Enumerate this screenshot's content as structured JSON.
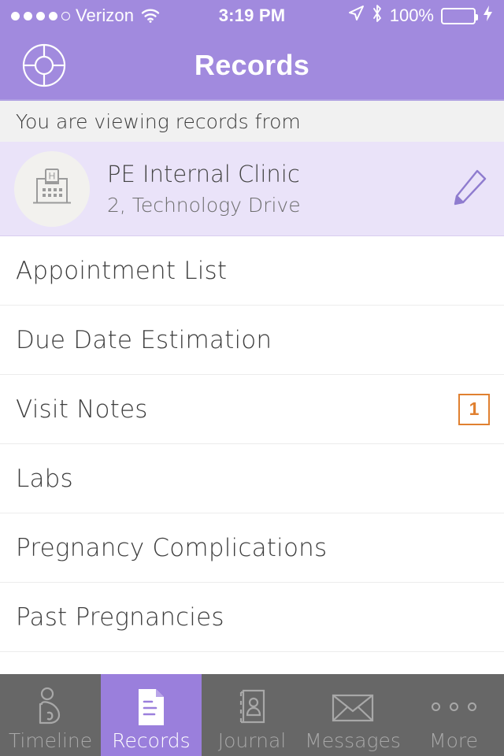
{
  "statusbar": {
    "carrier": "Verizon",
    "signal_filled": 4,
    "signal_total": 5,
    "wifi_icon": "wifi-icon",
    "time": "3:19 PM",
    "location_icon": "location-arrow-icon",
    "bluetooth_icon": "bluetooth-icon",
    "battery_percent": "100%",
    "battery_level": 100,
    "charging_icon": "lightning-bolt-icon",
    "battery_color": "#4cd964"
  },
  "navbar": {
    "title": "Records",
    "logo_icon": "target-lifebuoy-icon",
    "background": "#a18ade"
  },
  "banner": {
    "text": "You are viewing records from",
    "background": "#f1f1f1"
  },
  "clinic": {
    "icon": "hospital-building-icon",
    "name": "PE Internal Clinic",
    "address": "2, Technology Drive",
    "edit_icon": "pencil-edit-icon",
    "background": "#eae3f9"
  },
  "menu": {
    "items": [
      {
        "label": "Appointment List",
        "badge": null
      },
      {
        "label": "Due Date Estimation",
        "badge": null
      },
      {
        "label": "Visit Notes",
        "badge": "1"
      },
      {
        "label": "Labs",
        "badge": null
      },
      {
        "label": "Pregnancy Complications",
        "badge": null
      },
      {
        "label": "Past Pregnancies",
        "badge": null
      }
    ],
    "badge_color": "#e08030"
  },
  "tabbar": {
    "background": "#676767",
    "active_background": "#9a7fdc",
    "items": [
      {
        "label": "Timeline",
        "icon": "pregnant-woman-icon",
        "active": false
      },
      {
        "label": "Records",
        "icon": "document-icon",
        "active": true
      },
      {
        "label": "Journal",
        "icon": "journal-book-icon",
        "active": false
      },
      {
        "label": "Messages",
        "icon": "envelope-icon",
        "active": false
      },
      {
        "label": "More",
        "icon": "ellipsis-icon",
        "active": false
      }
    ]
  }
}
